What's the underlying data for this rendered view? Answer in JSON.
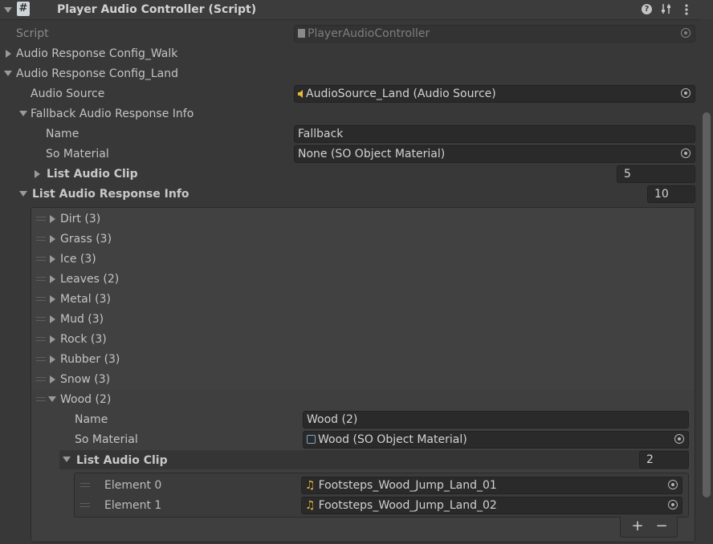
{
  "component": {
    "title": "Player Audio Controller (Script)",
    "header_icons": [
      "help-icon",
      "preset-icon",
      "more-icon"
    ]
  },
  "script": {
    "label": "Script",
    "value": "PlayerAudioController"
  },
  "config_walk": {
    "label": "Audio Response Config_Walk"
  },
  "config_land": {
    "label": "Audio Response Config_Land",
    "audio_source": {
      "label": "Audio Source",
      "value": "AudioSource_Land (Audio Source)"
    },
    "fallback": {
      "label": "Fallback Audio Response Info",
      "name_label": "Name",
      "name_value": "Fallback",
      "so_material_label": "So Material",
      "so_material_value": "None (SO Object Material)",
      "list_audio_clip_label": "List Audio Clip",
      "list_audio_clip_count": "5"
    },
    "list_info": {
      "label": "List Audio Response Info",
      "count": "10",
      "items": [
        "Dirt (3)",
        "Grass (3)",
        "Ice (3)",
        "Leaves (2)",
        "Metal (3)",
        "Mud (3)",
        "Rock (3)",
        "Rubber (3)",
        "Snow (3)"
      ],
      "wood": {
        "label": "Wood (2)",
        "name_label": "Name",
        "name_value": "Wood (2)",
        "so_material_label": "So Material",
        "so_material_value": "Wood (SO Object Material)",
        "list_audio_clip_label": "List Audio Clip",
        "list_audio_clip_count": "2",
        "elements": [
          {
            "label": "Element 0",
            "value": "Footsteps_Wood_Jump_Land_01"
          },
          {
            "label": "Element 1",
            "value": "Footsteps_Wood_Jump_Land_02"
          }
        ]
      }
    }
  },
  "footer": {
    "add": "+",
    "remove": "−"
  },
  "colors": {
    "accent_yellow": "#e8b93a",
    "panel": "#383838",
    "field": "#2a2a2a"
  }
}
